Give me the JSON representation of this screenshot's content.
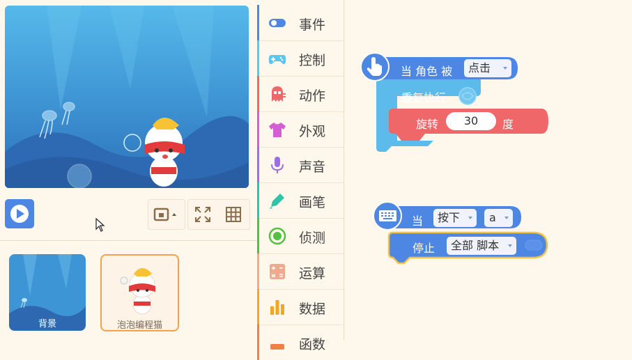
{
  "stage_controls": {
    "play_icon": "play-icon",
    "view_icon": "small-stage-icon",
    "fullscreen_icon": "fullscreen-icon",
    "grid_icon": "grid-icon"
  },
  "sprites": [
    {
      "name": "背景"
    },
    {
      "name": "泡泡编程猫"
    }
  ],
  "categories": [
    {
      "label": "事件",
      "color": "#4e86e4",
      "icon": "toggle-icon"
    },
    {
      "label": "控制",
      "color": "#5cc5f0",
      "icon": "gamepad-icon"
    },
    {
      "label": "动作",
      "color": "#ef6768",
      "icon": "ghost-icon"
    },
    {
      "label": "外观",
      "color": "#d45ed4",
      "icon": "shirt-icon"
    },
    {
      "label": "声音",
      "color": "#9b6ee8",
      "icon": "microphone-icon"
    },
    {
      "label": "画笔",
      "color": "#2ec4a8",
      "icon": "pen-icon"
    },
    {
      "label": "侦测",
      "color": "#53c13f",
      "icon": "target-icon"
    },
    {
      "label": "运算",
      "color": "#f1a98d",
      "icon": "calculator-icon"
    },
    {
      "label": "数据",
      "color": "#f4a623",
      "icon": "bar-chart-icon"
    },
    {
      "label": "函数",
      "color": "#f07f4a",
      "icon": "function-icon"
    }
  ],
  "script1": {
    "hat_label": "当 角色 被",
    "hat_dropdown": "点击",
    "repeat_label": "重复执行",
    "rotate_label": "旋转",
    "rotate_value": "30",
    "rotate_unit": "度"
  },
  "script2": {
    "hat_label": "当",
    "key_dropdown": "按下",
    "key_value": "a",
    "stop_label": "停止",
    "stop_dropdown": "全部 脚本"
  },
  "colors": {
    "event": "#4e86e4",
    "control": "#5cbbea",
    "motion": "#ef6768",
    "selected_outline": "#f5c33f"
  }
}
